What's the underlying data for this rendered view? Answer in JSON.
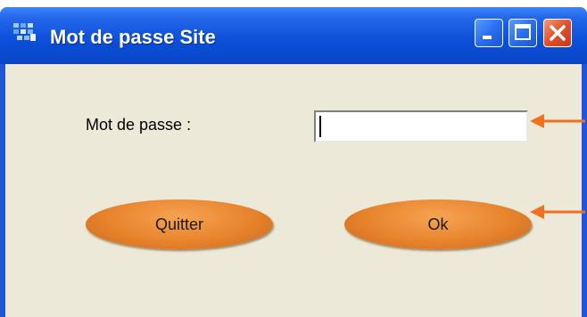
{
  "window": {
    "title": "Mot de passe Site",
    "controls": {
      "minimize": "minimize-icon",
      "maximize": "maximize-icon",
      "close": "close-icon"
    }
  },
  "form": {
    "password_label": "Mot de passe :",
    "password_value": ""
  },
  "buttons": {
    "quit_label": "Quitter",
    "ok_label": "Ok"
  },
  "colors": {
    "titlebar": "#0b4ed8",
    "client_bg": "#ece9d8",
    "button_orange": "#e8832c",
    "annotation_arrow": "#f07020",
    "close_red": "#e0502a"
  },
  "annotations": {
    "arrows": [
      "arrow-icon",
      "arrow-icon"
    ]
  }
}
